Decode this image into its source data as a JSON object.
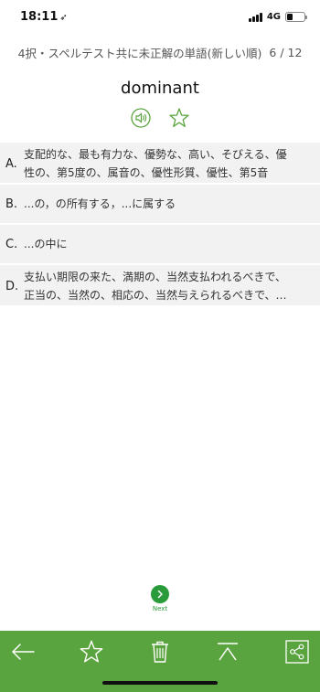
{
  "status_bar": {
    "time": "18:11",
    "location_glyph": "➶",
    "network": "4G",
    "battery_level_percent": 35
  },
  "header": {
    "title": "4択・スペルテスト共に未正解の単語(新しい順)",
    "counter": "6 / 12"
  },
  "word": "dominant",
  "icons": {
    "speaker": "speaker-icon",
    "favorite": "star-icon"
  },
  "choices": [
    {
      "letter": "A.",
      "lines": [
        "支配的な、最も有力な、優勢な、高い、そびえる、優",
        "性の、第5度の、属音の、優性形質、優性、第5音"
      ]
    },
    {
      "letter": "B.",
      "text": "...の，の所有する，...に属する"
    },
    {
      "letter": "C.",
      "text": "...の中に"
    },
    {
      "letter": "D.",
      "lines": [
        "支払い期限の来た、満期の、当然支払われるべきで、",
        "正当の、当然の、相応の、当然与えられるべきで、…"
      ]
    }
  ],
  "next": {
    "label": "Next"
  },
  "toolbar": {
    "accent": "#5aa43f",
    "items": [
      "back-arrow-icon",
      "star-icon",
      "trash-icon",
      "scroll-top-icon",
      "share-icon"
    ]
  }
}
